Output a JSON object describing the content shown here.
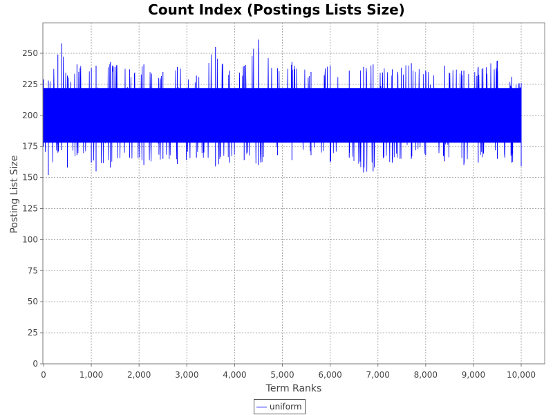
{
  "chart_data": {
    "type": "line",
    "title": "Count Index (Postings Lists Size)",
    "xlabel": "Term Ranks",
    "ylabel": "Posting List Size",
    "xlim": [
      0,
      10000
    ],
    "ylim": [
      0,
      262
    ],
    "xticks": [
      0,
      1000,
      2000,
      3000,
      4000,
      5000,
      6000,
      7000,
      8000,
      9000,
      10000
    ],
    "xtick_labels": [
      "0",
      "1,000",
      "2,000",
      "3,000",
      "4,000",
      "5,000",
      "6,000",
      "7,000",
      "8,000",
      "9,000",
      "10,000"
    ],
    "yticks": [
      0,
      25,
      50,
      75,
      100,
      125,
      150,
      175,
      200,
      225,
      250
    ],
    "yticks_labels": [
      "0",
      "25",
      "50",
      "75",
      "100",
      "125",
      "150",
      "175",
      "200",
      "225",
      "250"
    ],
    "grid": true,
    "legend_position": "bottom-center",
    "series": [
      {
        "name": "uniform",
        "color": "#0000ff",
        "n_points": 10000,
        "mean": 200,
        "band": [
          178,
          222
        ],
        "envelope": [
          {
            "x": 0,
            "min": 175,
            "max": 229
          },
          {
            "x": 100,
            "min": 152,
            "max": 228
          },
          {
            "x": 300,
            "min": 170,
            "max": 249
          },
          {
            "x": 380,
            "min": 172,
            "max": 258
          },
          {
            "x": 500,
            "min": 158,
            "max": 232
          },
          {
            "x": 700,
            "min": 168,
            "max": 241
          },
          {
            "x": 1000,
            "min": 162,
            "max": 238
          },
          {
            "x": 1100,
            "min": 155,
            "max": 240
          },
          {
            "x": 1400,
            "min": 158,
            "max": 243
          },
          {
            "x": 1800,
            "min": 166,
            "max": 237
          },
          {
            "x": 2100,
            "min": 160,
            "max": 241
          },
          {
            "x": 2500,
            "min": 165,
            "max": 235
          },
          {
            "x": 2800,
            "min": 161,
            "max": 239
          },
          {
            "x": 3200,
            "min": 166,
            "max": 232
          },
          {
            "x": 3600,
            "min": 159,
            "max": 255
          },
          {
            "x": 3900,
            "min": 162,
            "max": 236
          },
          {
            "x": 4200,
            "min": 164,
            "max": 240
          },
          {
            "x": 4500,
            "min": 160,
            "max": 261
          },
          {
            "x": 4900,
            "min": 168,
            "max": 238
          },
          {
            "x": 5200,
            "min": 164,
            "max": 243
          },
          {
            "x": 5600,
            "min": 168,
            "max": 235
          },
          {
            "x": 6000,
            "min": 162,
            "max": 240
          },
          {
            "x": 6400,
            "min": 166,
            "max": 236
          },
          {
            "x": 6700,
            "min": 154,
            "max": 239
          },
          {
            "x": 6900,
            "min": 155,
            "max": 241
          },
          {
            "x": 7300,
            "min": 162,
            "max": 237
          },
          {
            "x": 7700,
            "min": 165,
            "max": 242
          },
          {
            "x": 8000,
            "min": 168,
            "max": 236
          },
          {
            "x": 8400,
            "min": 163,
            "max": 240
          },
          {
            "x": 8800,
            "min": 160,
            "max": 236
          },
          {
            "x": 9100,
            "min": 162,
            "max": 239
          },
          {
            "x": 9500,
            "min": 165,
            "max": 244
          },
          {
            "x": 9800,
            "min": 162,
            "max": 231
          },
          {
            "x": 10000,
            "min": 159,
            "max": 226
          }
        ]
      }
    ]
  }
}
